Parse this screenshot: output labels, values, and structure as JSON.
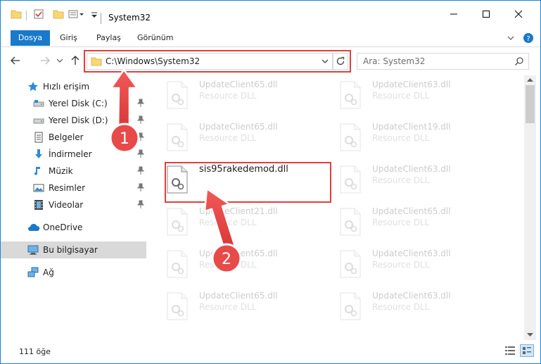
{
  "window": {
    "title": "System32"
  },
  "ribbon": {
    "tabs": [
      {
        "label": "Dosya",
        "active": true
      },
      {
        "label": "Giriş"
      },
      {
        "label": "Paylaş"
      },
      {
        "label": "Görünüm"
      }
    ]
  },
  "address": {
    "path": "C:\\Windows\\System32"
  },
  "search": {
    "placeholder": "Ara: System32"
  },
  "sidebar": {
    "items": [
      {
        "label": "Hızlı erişim",
        "icon": "star-icon"
      },
      {
        "label": "Yerel Disk (C:)",
        "icon": "drive-icon",
        "pinned": true
      },
      {
        "label": "Yerel Disk (D:)",
        "icon": "drive-icon",
        "pinned": true
      },
      {
        "label": "Belgeler",
        "icon": "documents-icon",
        "pinned": true
      },
      {
        "label": "İndirmeler",
        "icon": "download-icon",
        "pinned": true
      },
      {
        "label": "Müzik",
        "icon": "music-icon",
        "pinned": true
      },
      {
        "label": "Resimler",
        "icon": "pictures-icon",
        "pinned": true
      },
      {
        "label": "Videolar",
        "icon": "videos-icon",
        "pinned": true
      },
      {
        "label": "OneDrive",
        "icon": "cloud-icon"
      },
      {
        "label": "Bu bilgisayar",
        "icon": "computer-icon",
        "selected": true
      },
      {
        "label": "Ağ",
        "icon": "network-icon"
      }
    ]
  },
  "files": {
    "left": [
      {
        "name": "UpdateClient65.dll",
        "type": "Resource DLL"
      },
      {
        "name": "UpdateClient65.dll",
        "type": "Resource DLL"
      },
      {
        "name": "sis95rakedemod.dll",
        "type": ""
      },
      {
        "name": "UpdateClient21.dll",
        "type": "Resource DLL"
      },
      {
        "name": "UpdateClient65.dll",
        "type": "Resource DLL"
      },
      {
        "name": "UpdateClient65.dll",
        "type": "Resource DLL"
      }
    ],
    "right": [
      {
        "name": "UpdateClient63.dll",
        "type": "Resource DLL"
      },
      {
        "name": "UpdateClient19.dll",
        "type": "Resource DLL"
      },
      {
        "name": "UpdateClient63.dll",
        "type": "Resource DLL"
      },
      {
        "name": "UpdateClient65.dll",
        "type": "Resource DLL"
      },
      {
        "name": "UpdateClient63.dll",
        "type": "Resource DLL"
      },
      {
        "name": "UpdateClient63.dll",
        "type": "Resource DLL"
      }
    ]
  },
  "status": {
    "count": "111 öğe"
  },
  "annotations": {
    "step1": "1",
    "step2": "2"
  },
  "colors": {
    "accent": "#1979ca",
    "highlight": "#e03f3f",
    "arrow": "#e84a4a"
  }
}
